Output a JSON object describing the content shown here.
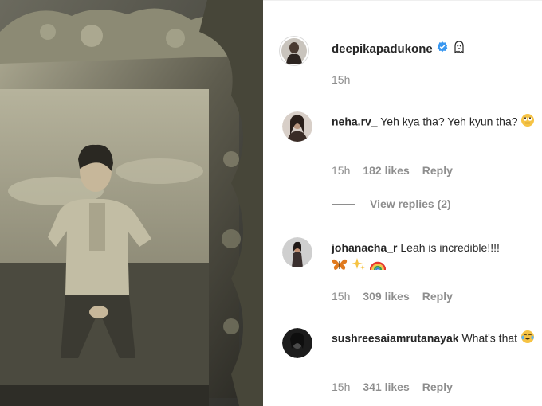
{
  "post": {
    "owner": {
      "username": "deepikapadukone",
      "time": "15h",
      "verified_icon": "verified-badge-icon",
      "extra_icon": "ghost-emoji"
    }
  },
  "comments": [
    {
      "username": "neha.rv_",
      "text": "Yeh kya tha? Yeh kyun tha?",
      "emoji": "rolling-eyes-emoji",
      "time": "15h",
      "likes": "182 likes",
      "reply": "Reply",
      "view_replies": "View replies (2)"
    },
    {
      "username": "johanacha_r",
      "text": "Leah is incredible!!!!",
      "emoji": "butterfly-sparkles-rainbow-emoji",
      "time": "15h",
      "likes": "309 likes",
      "reply": "Reply"
    },
    {
      "username": "sushreesaiamrutanayak",
      "text": "What's that",
      "emoji": "tears-of-joy-emoji",
      "time": "15h",
      "likes": "341 likes",
      "reply": "Reply"
    }
  ],
  "colors": {
    "text": "#262626",
    "secondary": "#8e8e8e",
    "verified": "#3897f0"
  }
}
